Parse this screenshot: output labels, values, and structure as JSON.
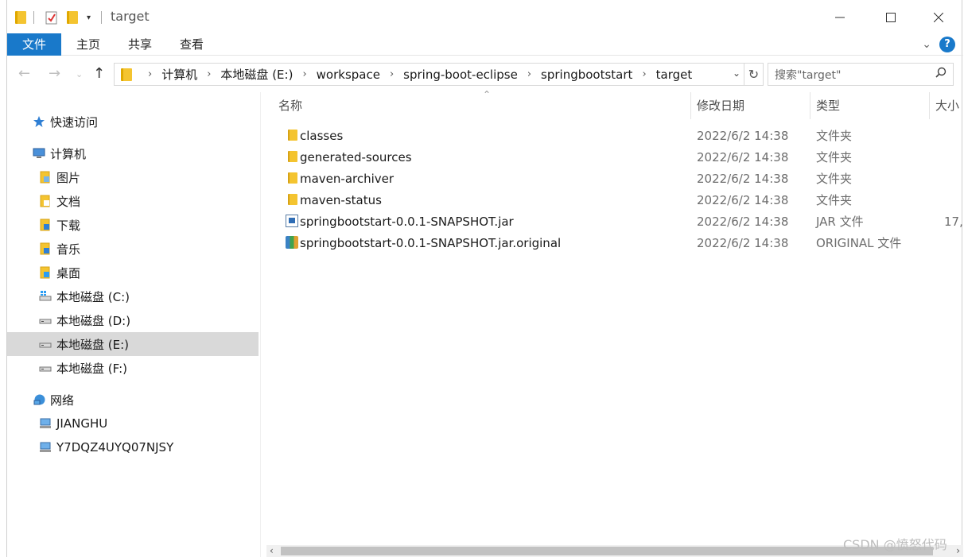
{
  "window": {
    "title": "target"
  },
  "ribbon": {
    "tabs": [
      "文件",
      "主页",
      "共享",
      "查看"
    ]
  },
  "address": {
    "crumbs": [
      "计算机",
      "本地磁盘 (E:)",
      "workspace",
      "spring-boot-eclipse",
      "springbootstart",
      "target"
    ],
    "search_placeholder": "搜索\"target\""
  },
  "nav": {
    "items": [
      {
        "label": "快速访问",
        "icon": "star-icon",
        "indent": 0,
        "selected": false
      },
      {
        "label": "计算机",
        "icon": "computer-icon",
        "indent": 0,
        "selected": false
      },
      {
        "label": "图片",
        "icon": "pictures-folder-icon",
        "indent": 1,
        "selected": false
      },
      {
        "label": "文档",
        "icon": "documents-folder-icon",
        "indent": 1,
        "selected": false
      },
      {
        "label": "下载",
        "icon": "downloads-folder-icon",
        "indent": 1,
        "selected": false
      },
      {
        "label": "音乐",
        "icon": "music-folder-icon",
        "indent": 1,
        "selected": false
      },
      {
        "label": "桌面",
        "icon": "desktop-folder-icon",
        "indent": 1,
        "selected": false
      },
      {
        "label": "本地磁盘 (C:)",
        "icon": "windows-drive-icon",
        "indent": 1,
        "selected": false
      },
      {
        "label": "本地磁盘 (D:)",
        "icon": "drive-icon",
        "indent": 1,
        "selected": false
      },
      {
        "label": "本地磁盘 (E:)",
        "icon": "drive-icon",
        "indent": 1,
        "selected": true
      },
      {
        "label": "本地磁盘 (F:)",
        "icon": "drive-icon",
        "indent": 1,
        "selected": false
      },
      {
        "label": "网络",
        "icon": "network-icon",
        "indent": 0,
        "selected": false
      },
      {
        "label": "JIANGHU",
        "icon": "network-computer-icon",
        "indent": 1,
        "selected": false
      },
      {
        "label": "Y7DQZ4UYQ07NJSY",
        "icon": "network-computer-icon",
        "indent": 1,
        "selected": false
      }
    ]
  },
  "columns": {
    "name": "名称",
    "date": "修改日期",
    "type": "类型",
    "size": "大小"
  },
  "files": [
    {
      "name": "classes",
      "date": "2022/6/2 14:38",
      "type": "文件夹",
      "size": "",
      "icon": "folder-icon"
    },
    {
      "name": "generated-sources",
      "date": "2022/6/2 14:38",
      "type": "文件夹",
      "size": "",
      "icon": "folder-icon"
    },
    {
      "name": "maven-archiver",
      "date": "2022/6/2 14:38",
      "type": "文件夹",
      "size": "",
      "icon": "folder-icon"
    },
    {
      "name": "maven-status",
      "date": "2022/6/2 14:38",
      "type": "文件夹",
      "size": "",
      "icon": "folder-icon"
    },
    {
      "name": "springbootstart-0.0.1-SNAPSHOT.jar",
      "date": "2022/6/2 14:38",
      "type": "JAR 文件",
      "size": "17,",
      "icon": "jar-file-icon"
    },
    {
      "name": "springbootstart-0.0.1-SNAPSHOT.jar.original",
      "date": "2022/6/2 14:38",
      "type": "ORIGINAL 文件",
      "size": "",
      "icon": "archive-file-icon"
    }
  ],
  "watermark": "CSDN @愤怒代码"
}
